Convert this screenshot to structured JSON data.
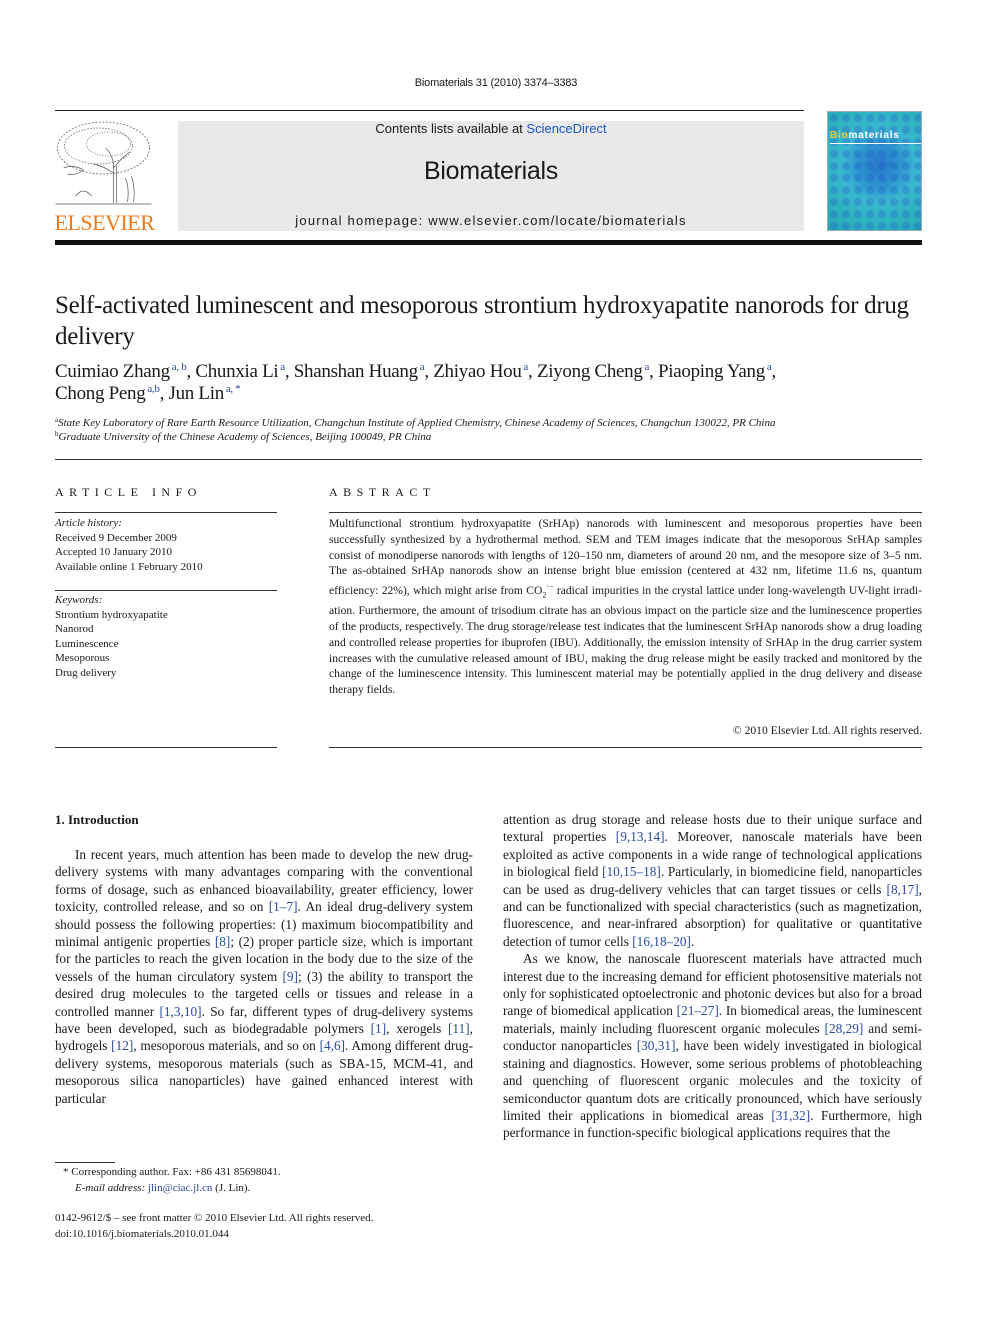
{
  "running_head": "Biomaterials 31 (2010) 3374–3383",
  "masthead": {
    "contents_prefix": "Contents lists available at ",
    "contents_link": "ScienceDirect",
    "journal_name": "Biomaterials",
    "homepage": "journal homepage: www.elsevier.com/locate/biomaterials",
    "publisher_wordmark": "ELSEVIER",
    "cover_title_bio": "Bio",
    "cover_title_rest": "materials"
  },
  "colors": {
    "link": "#2a4a9e",
    "sciencedirect": "#1a56c8",
    "elsevier_orange": "#f07a1a",
    "masthead_bg": "#e9e9e9"
  },
  "article": {
    "title": "Self-activated luminescent and mesoporous strontium hydroxyapatite nanorods for drug delivery",
    "authors": [
      {
        "name": "Cuimiao Zhang",
        "aff": "a, b"
      },
      {
        "name": "Chunxia Li",
        "aff": "a"
      },
      {
        "name": "Shanshan Huang",
        "aff": "a"
      },
      {
        "name": "Zhiyao Hou",
        "aff": "a"
      },
      {
        "name": "Ziyong Cheng",
        "aff": "a"
      },
      {
        "name": "Piaoping Yang",
        "aff": "a"
      },
      {
        "name": "Chong Peng",
        "aff": "a,b"
      },
      {
        "name": "Jun Lin",
        "aff": "a, *"
      }
    ],
    "affiliations": [
      {
        "mark": "a",
        "text": "State Key Laboratory of Rare Earth Resource Utilization, Changchun Institute of Applied Chemistry, Chinese Academy of Sciences, Changchun 130022, PR China"
      },
      {
        "mark": "b",
        "text": "Graduate University of the Chinese Academy of Sciences, Beijing 100049, PR China"
      }
    ]
  },
  "article_info": {
    "heading": "ARTICLE INFO",
    "history_label": "Article history:",
    "history": [
      "Received 9 December 2009",
      "Accepted 10 January 2010",
      "Available online 1 February 2010"
    ],
    "keywords_label": "Keywords:",
    "keywords": [
      "Strontium hydroxyapatite",
      "Nanorod",
      "Luminescence",
      "Mesoporous",
      "Drug delivery"
    ]
  },
  "abstract": {
    "heading": "ABSTRACT",
    "text_before_co2": "Multifunctional strontium hydroxyapatite (SrHAp) nanorods with luminescent and mesoporous prop­erties have been successfully synthesized by a hydrothermal method. SEM and TEM images indicate that the mesoporous SrHAp samples consist of monodiperse nanorods with lengths of 120–150 nm, diam­eters of around 20 nm, and the mesopore size of 3–5 nm. The as-obtained SrHAp nanorods show an intense bright blue emission (centered at 432 nm, lifetime 11.6 ns, quantum efficiency: 22%), which might arise from ",
    "co2_base": "CO",
    "co2_sub": "2",
    "co2_sup": "·−",
    "text_after_co2": " radical impurities in the crystal lattice under long-wavelength UV-light irradi­ation. Furthermore, the amount of trisodium citrate has an obvious impact on the particle size and the luminescence properties of the products, respectively. The drug storage/release test indicates that the luminescent SrHAp nanorods show a drug loading and controlled release properties for ibuprofen (IBU). Additionally, the emission intensity of SrHAp in the drug carrier system increases with the cumulative released amount of IBU, making the drug release might be easily tracked and monitored by the change of the luminescence intensity. This luminescent material may be potentially applied in the drug delivery and disease therapy fields.",
    "copyright": "© 2010 Elsevier Ltd. All rights reserved."
  },
  "introduction": {
    "heading": "1.  Introduction",
    "left_col": [
      {
        "t": "In recent years, much attention has been made to develop the new drug-delivery systems with many advantages comparing with the conventional forms of dosage, such as enhanced bioavailability, greater efficiency, lower toxicity, controlled release, and so on "
      },
      {
        "c": "[1–7]"
      },
      {
        "t": ". An ideal drug-delivery system should possess the following properties: (1) maximum biocompatibility and minimal antigenic properties "
      },
      {
        "c": "[8]"
      },
      {
        "t": "; (2) proper particle size, which is important for the particles to reach the given location in the body due to the size of the vessels of the human circulatory system "
      },
      {
        "c": "[9]"
      },
      {
        "t": "; (3) the ability to transport the desired drug molecules to the targeted cells or tissues and release in a controlled manner "
      },
      {
        "c": "[1,3,10]"
      },
      {
        "t": ". So far, different types of drug-delivery systems have been developed, such as biodegradable polymers "
      },
      {
        "c": "[1]"
      },
      {
        "t": ", xerogels "
      },
      {
        "c": "[11]"
      },
      {
        "t": ", hydrogels "
      },
      {
        "c": "[12]"
      },
      {
        "t": ", mesoporous materials, and so on "
      },
      {
        "c": "[4,6]"
      },
      {
        "t": ". Among different drug-delivery systems, meso­porous materials (such as SBA-15, MCM-41, and mesoporous silica nanoparticles) have gained enhanced interest with particular"
      }
    ],
    "right_col_p1": [
      {
        "t": "attention as drug storage and release hosts due to their unique surface and textural properties "
      },
      {
        "c": "[9,13,14]"
      },
      {
        "t": ". Moreover, nanoscale materials have been exploited as active components in a wide range of technological applications in biological field "
      },
      {
        "c": "[10,15–18]"
      },
      {
        "t": ". Particularly, in biomedicine field, nanoparticles can be used as drug-delivery vehicles that can target tissues or cells "
      },
      {
        "c": "[8,17]"
      },
      {
        "t": ", and can be functionalized with special characteristics (such as magnetiza­tion, fluorescence, and near-infrared absorption) for qualitative or quantitative detection of tumor cells "
      },
      {
        "c": "[16,18–20]"
      },
      {
        "t": "."
      }
    ],
    "right_col_p2": [
      {
        "t": "As we know, the nanoscale fluorescent materials have attracted much interest due to the increasing demand for efficient photo­sensitive materials not only for sophisticated optoelectronic and photonic devices but also for a broad range of biomedical applica­tion "
      },
      {
        "c": "[21–27]"
      },
      {
        "t": ". In biomedical areas, the luminescent materials, mainly including fluorescent organic molecules "
      },
      {
        "c": "[28,29]"
      },
      {
        "t": " and semi­conductor nanoparticles "
      },
      {
        "c": "[30,31]"
      },
      {
        "t": ", have been widely investigated in biological staining and diagnostics. However, some serious prob­lems of photobleaching and quenching of fluorescent organic molecules and the toxicity of semiconductor quantum dots are critically pronounced, which have seriously limited their applica­tions in biomedical areas "
      },
      {
        "c": "[31,32]"
      },
      {
        "t": ". Furthermore, high performance in function-specific biological applications requires that the"
      }
    ]
  },
  "footnotes": {
    "corresponding": "*  Corresponding author. Fax: +86 431 85698041.",
    "email_label": "E-mail address:",
    "email": "jlin@ciac.jl.cn",
    "email_suffix": " (J. Lin).",
    "issn_line": "0142-9612/$ – see front matter © 2010 Elsevier Ltd. All rights reserved.",
    "doi": "doi:10.1016/j.biomaterials.2010.01.044"
  }
}
